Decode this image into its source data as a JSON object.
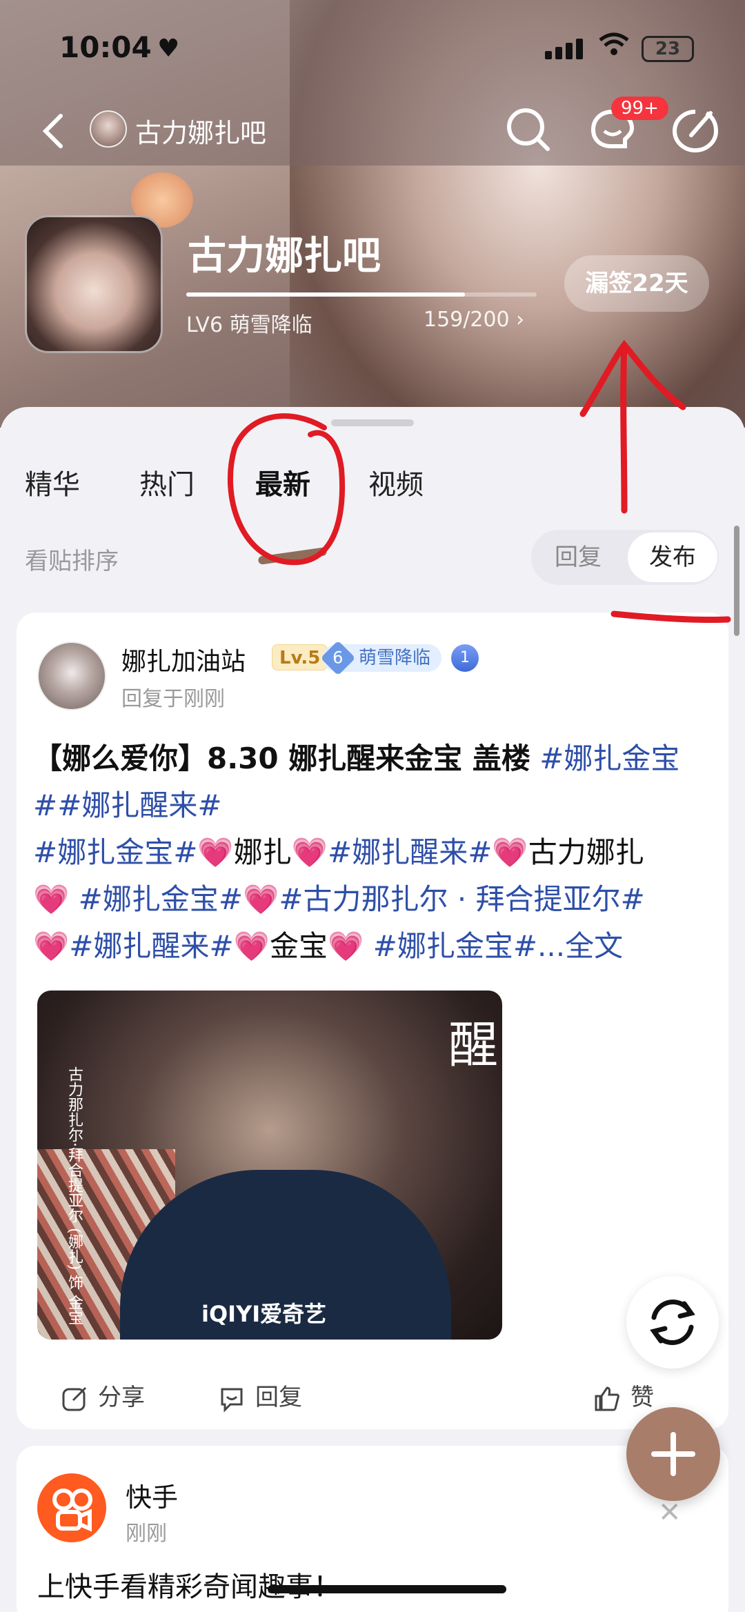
{
  "status_bar": {
    "time": "10:04",
    "battery": "23"
  },
  "nav": {
    "title": "古力娜扎吧",
    "badge": "99+"
  },
  "forum": {
    "name": "古力娜扎吧",
    "level": "LV6 萌雪降临",
    "exp": "159/200",
    "exp_progress": 0.795,
    "sign_button": "漏签22天"
  },
  "tabs": [
    "精华",
    "热门",
    "最新",
    "视频"
  ],
  "active_tab": "最新",
  "sort": {
    "label": "看贴排序",
    "options": [
      "回复",
      "发布"
    ],
    "selected": "发布"
  },
  "post": {
    "author": "娜扎加油站",
    "level_badge": "Lv.5",
    "member_level": "6",
    "member_title": "萌雪降临",
    "meta": "回复于刚刚",
    "title_text": "【娜么爱你】8.30 娜扎醒来金宝 盖楼",
    "body_segments": [
      "#娜扎金宝#",
      "#娜扎醒来#",
      "#娜扎金宝#",
      "💗",
      "娜扎",
      "💗",
      "#娜扎醒来#",
      "💗",
      "古力娜扎",
      "💗",
      " #娜扎金宝#",
      "💗",
      "#古力那扎尔 · 拜合提亚尔#",
      "💗",
      "#娜扎醒来#",
      "💗",
      "金宝",
      "💗",
      " #娜扎金宝#",
      "...全文"
    ],
    "image": {
      "vertical_caption": "古力那扎尔·拜合提亚尔 (娜扎) 饰 金宝",
      "brand": "iQIYI爱奇艺",
      "big_char": "醒"
    },
    "actions": {
      "share": "分享",
      "reply": "回复",
      "like": "赞"
    }
  },
  "ad": {
    "name": "快手",
    "time": "刚刚",
    "text": "上快手看精彩奇闻趣事！"
  },
  "colors": {
    "hashtag": "#2e4fa8",
    "accent": "#a87d6a",
    "badge": "#f5343d"
  }
}
